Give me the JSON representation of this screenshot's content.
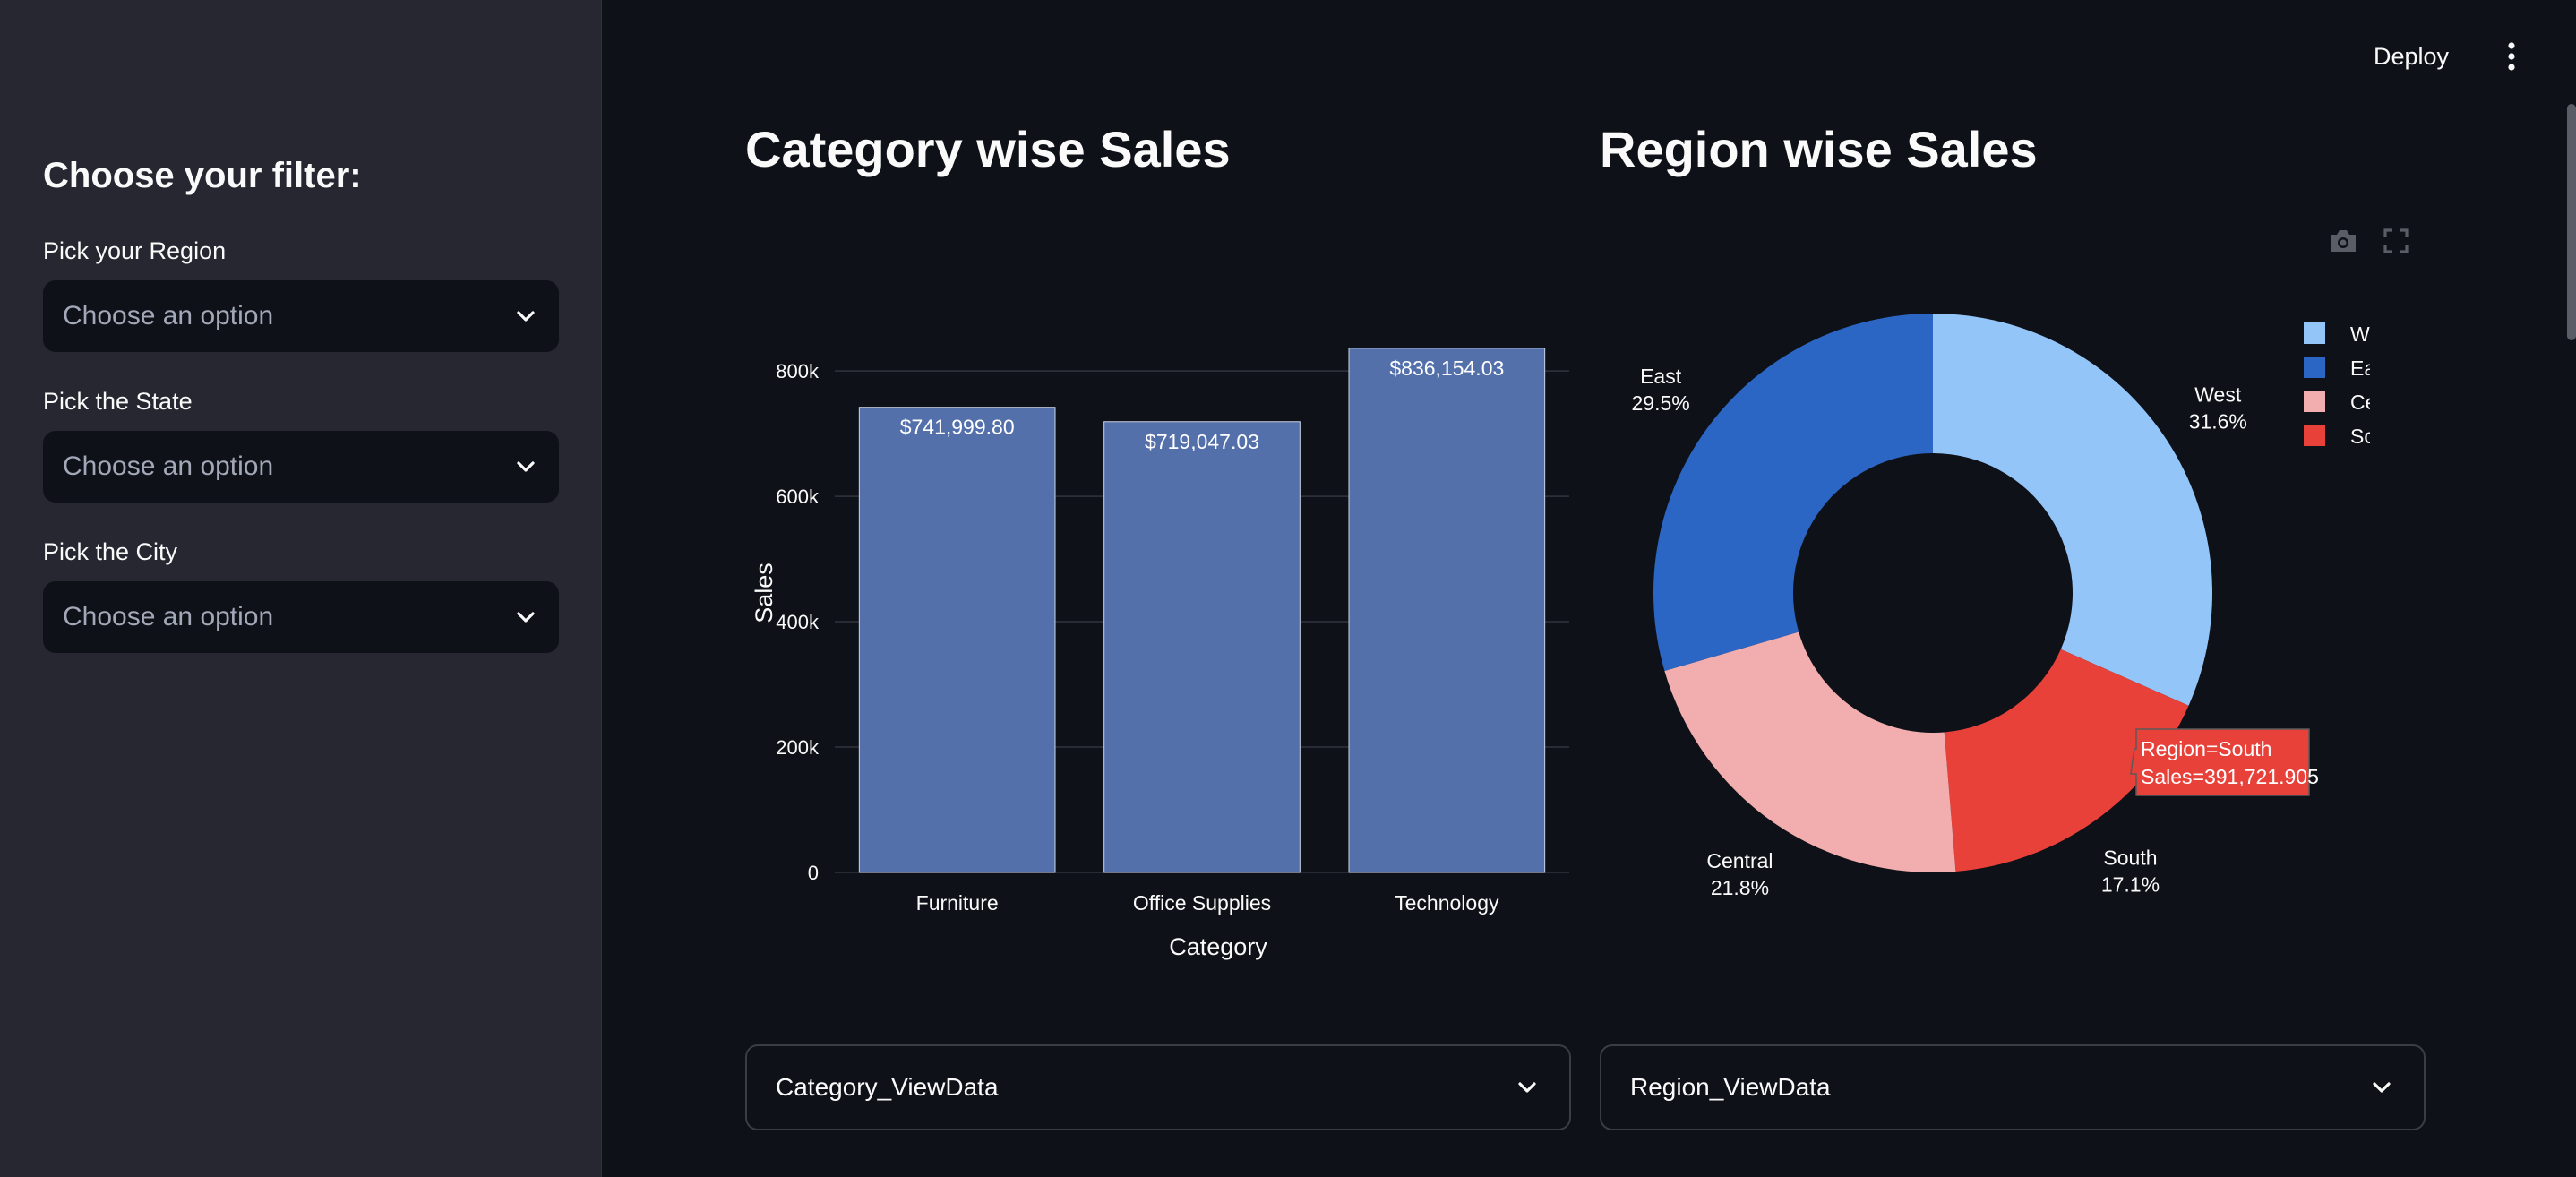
{
  "sidebar": {
    "title": "Choose your filter:",
    "filters": [
      {
        "label": "Pick your Region",
        "placeholder": "Choose an option"
      },
      {
        "label": "Pick the State",
        "placeholder": "Choose an option"
      },
      {
        "label": "Pick the City",
        "placeholder": "Choose an option"
      }
    ]
  },
  "header": {
    "deploy_label": "Deploy"
  },
  "category_section": {
    "title": "Category wise Sales",
    "expander_label": "Category_ViewData"
  },
  "region_section": {
    "title": "Region wise Sales",
    "expander_label": "Region_ViewData"
  },
  "tooltip": {
    "line1": "Region=South",
    "line2": "Sales=391,721.905"
  },
  "colors": {
    "bar": "#5470ab",
    "west": "#93c5f9",
    "east": "#2c66c4",
    "central": "#f2aeae",
    "south": "#e8413a",
    "background": "#0e1117",
    "sidebar": "#262730"
  },
  "chart_data": [
    {
      "type": "bar",
      "categories": [
        "Furniture",
        "Office Supplies",
        "Technology"
      ],
      "values": [
        741999.8,
        719047.03,
        836154.03
      ],
      "data_labels": [
        "$741,999.80",
        "$719,047.03",
        "$836,154.03"
      ],
      "xlabel": "Category",
      "ylabel": "Sales",
      "yticks": [
        "0",
        "200k",
        "400k",
        "600k",
        "800k"
      ],
      "ytick_values": [
        0,
        200000,
        400000,
        600000,
        800000
      ],
      "ylim": [
        0,
        880158
      ],
      "grid": true
    },
    {
      "type": "pie",
      "hole": true,
      "labels": [
        "West",
        "East",
        "Central",
        "South"
      ],
      "values": [
        31.6,
        29.5,
        21.8,
        17.1
      ],
      "percent_labels": [
        "31.6%",
        "29.5%",
        "21.8%",
        "17.1%"
      ],
      "legend": [
        "West",
        "East",
        "Central",
        "South"
      ],
      "legend_position": "top-right"
    }
  ]
}
